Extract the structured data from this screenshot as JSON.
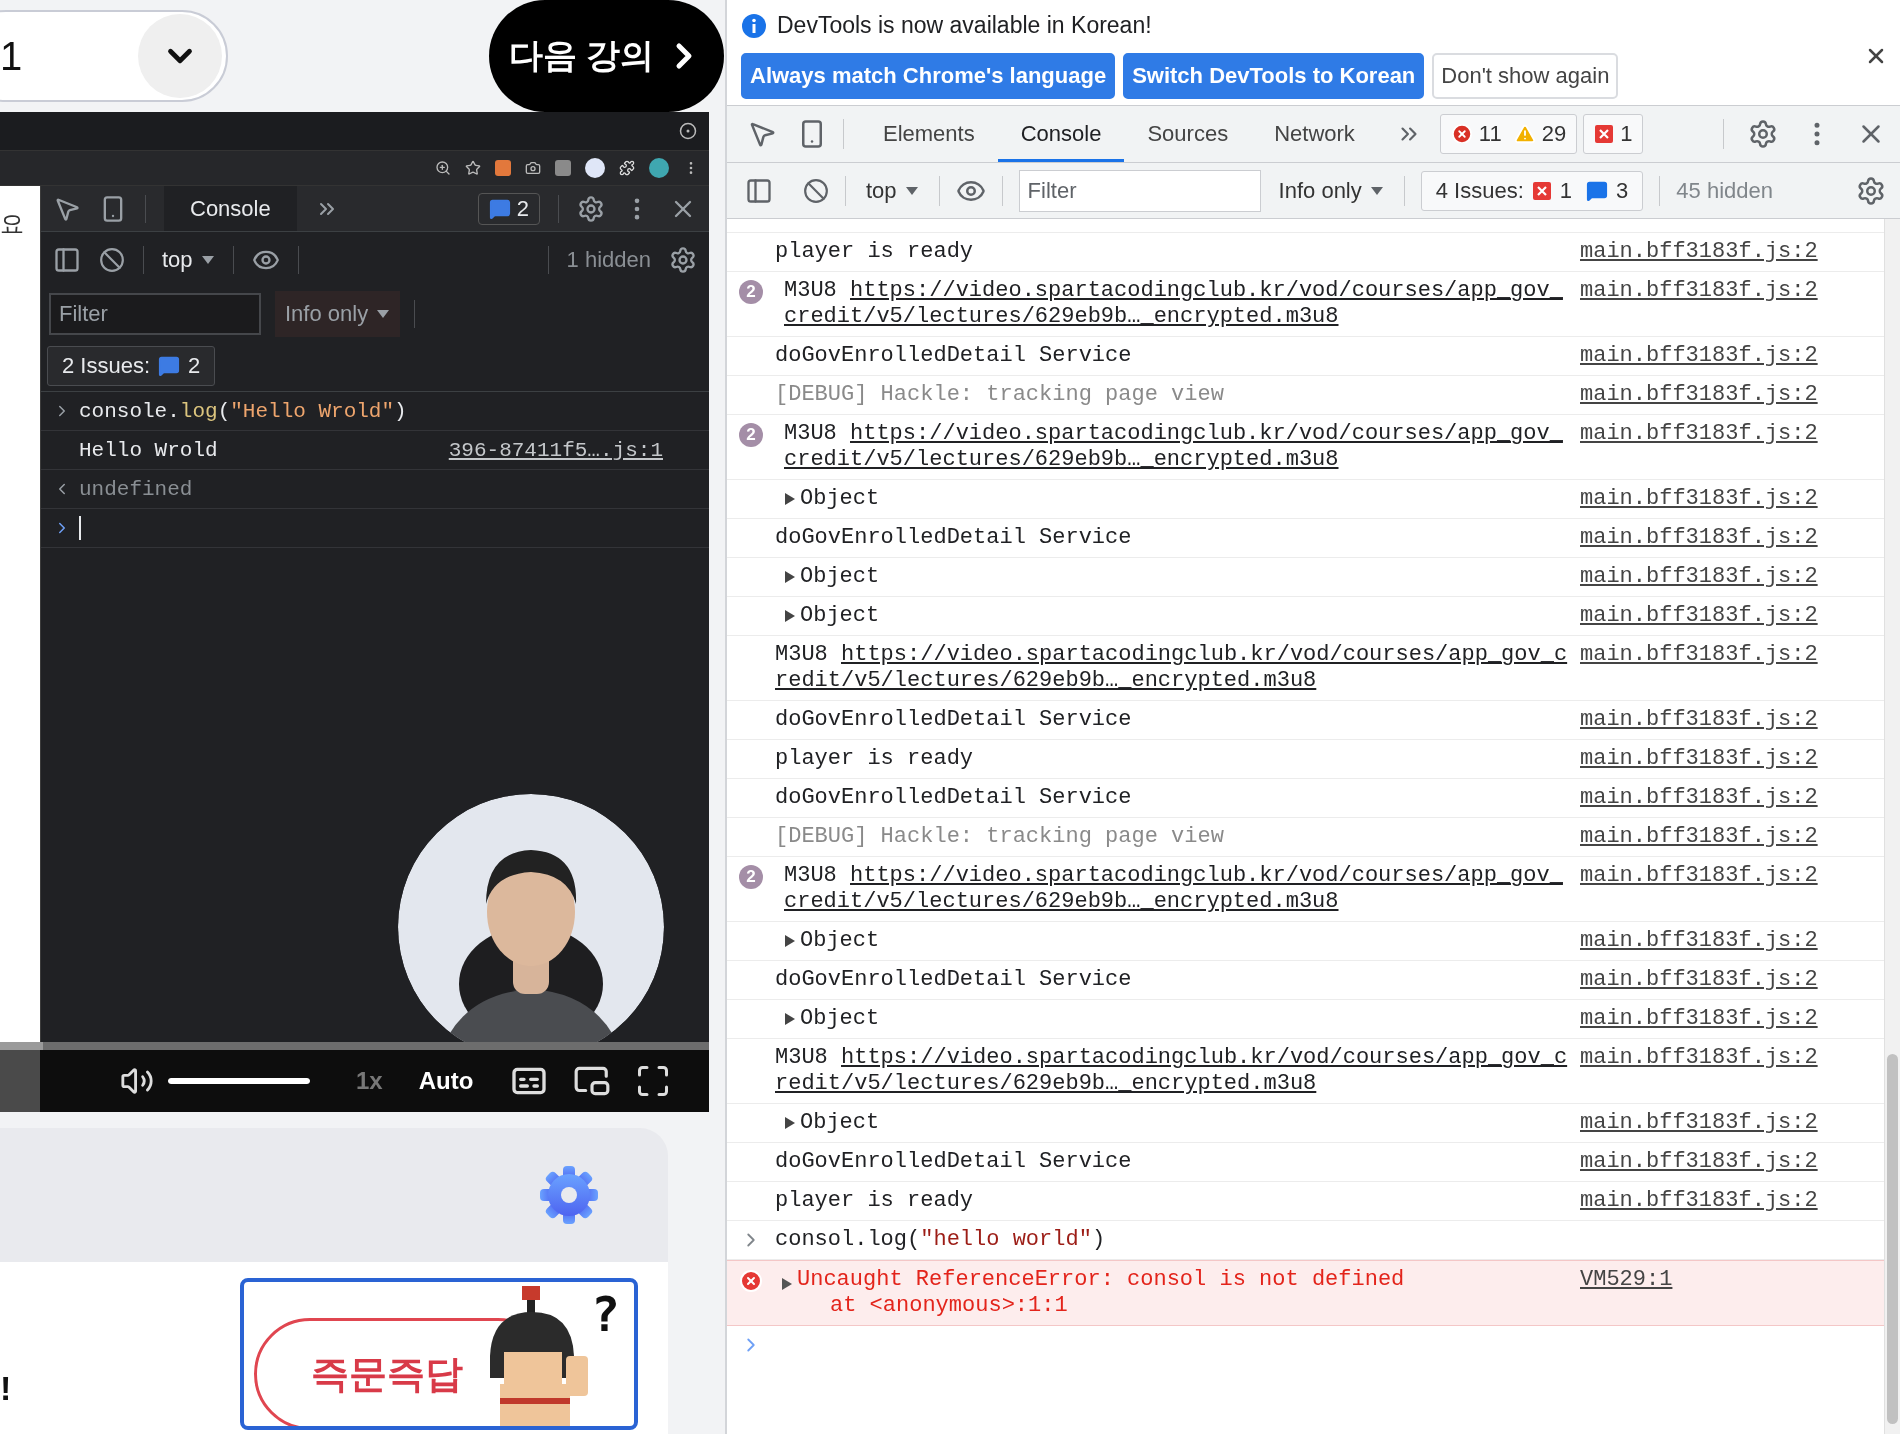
{
  "course_nav": {
    "lesson_select": "1",
    "next_button": "다음 강의"
  },
  "page_text": {
    "side": "요",
    "bottom": "!"
  },
  "video": {
    "devtools": {
      "tab": "Console",
      "message_badge": "2",
      "context": "top",
      "hidden": "1 hidden",
      "filter_placeholder": "Filter",
      "levels": "Info only",
      "issues_label": "2 Issues:",
      "issues_count": "2",
      "messages": [
        {
          "kind": "input",
          "tokens": [
            {
              "text": "console.",
              "kind": "plain"
            },
            {
              "text": "log",
              "kind": "method"
            },
            {
              "text": "(",
              "kind": "plain"
            },
            {
              "text": "\"Hello Wrold\"",
              "kind": "string"
            },
            {
              "text": ")",
              "kind": "plain"
            }
          ]
        },
        {
          "kind": "log",
          "text": "Hello Wrold",
          "source": "396-87411f5….js:1"
        },
        {
          "kind": "result",
          "text": "undefined"
        },
        {
          "kind": "prompt"
        }
      ]
    },
    "controls": {
      "progress": {
        "level": 0.06
      },
      "volume": {
        "level": 1
      },
      "speed": "1x",
      "quality": "Auto"
    }
  },
  "quiz_banner": {
    "label": "즉문즉답",
    "mark": "?"
  },
  "devtools": {
    "infobar": {
      "message": "DevTools is now available in Korean!",
      "buttons": [
        {
          "label": "Always match Chrome's language",
          "kind": "primary"
        },
        {
          "label": "Switch DevTools to Korean",
          "kind": "primary"
        },
        {
          "label": "Don't show again",
          "kind": "secondary"
        }
      ]
    },
    "tabs": [
      {
        "label": "Elements",
        "selected": false
      },
      {
        "label": "Console",
        "selected": true
      },
      {
        "label": "Sources",
        "selected": false
      },
      {
        "label": "Network",
        "selected": false
      }
    ],
    "counts": {
      "errors": "11",
      "warnings": "29",
      "issues": "1"
    },
    "toolbar": {
      "context": "top",
      "filter_placeholder": "Filter",
      "levels": "Info only",
      "issues_label": "4 Issues:",
      "issue_errors": "1",
      "issue_info": "3",
      "hidden": "45 hidden"
    },
    "messages": [
      {
        "kind": "log",
        "text": "player is ready",
        "source": "main.bff3183f.js:2"
      },
      {
        "kind": "url",
        "prefix": "M3U8",
        "url": "https://video.spartacodingclub.kr/vod/courses/app_gov_credit/v5/lectures/629eb9b…_encrypted.m3u8",
        "count": "2",
        "source": "main.bff3183f.js:2"
      },
      {
        "kind": "log",
        "text": "doGovEnrolledDetail Service",
        "source": "main.bff3183f.js:2"
      },
      {
        "kind": "debug",
        "text": "[DEBUG] Hackle: tracking page view",
        "source": "main.bff3183f.js:2"
      },
      {
        "kind": "url",
        "prefix": "M3U8",
        "url": "https://video.spartacodingclub.kr/vod/courses/app_gov_credit/v5/lectures/629eb9b…_encrypted.m3u8",
        "count": "2",
        "source": "main.bff3183f.js:2"
      },
      {
        "kind": "object",
        "text": "Object",
        "source": "main.bff3183f.js:2"
      },
      {
        "kind": "log",
        "text": "doGovEnrolledDetail Service",
        "source": "main.bff3183f.js:2"
      },
      {
        "kind": "object",
        "text": "Object",
        "source": "main.bff3183f.js:2"
      },
      {
        "kind": "object",
        "text": "Object",
        "source": "main.bff3183f.js:2"
      },
      {
        "kind": "url",
        "prefix": "M3U8",
        "url": "https://video.spartacodingclub.kr/vod/courses/app_gov_credit/v5/lectures/629eb9b…_encrypted.m3u8",
        "source": "main.bff3183f.js:2"
      },
      {
        "kind": "log",
        "text": "doGovEnrolledDetail Service",
        "source": "main.bff3183f.js:2"
      },
      {
        "kind": "log",
        "text": "player is ready",
        "source": "main.bff3183f.js:2"
      },
      {
        "kind": "log",
        "text": "doGovEnrolledDetail Service",
        "source": "main.bff3183f.js:2"
      },
      {
        "kind": "debug",
        "text": "[DEBUG] Hackle: tracking page view",
        "source": "main.bff3183f.js:2"
      },
      {
        "kind": "url",
        "prefix": "M3U8",
        "url": "https://video.spartacodingclub.kr/vod/courses/app_gov_credit/v5/lectures/629eb9b…_encrypted.m3u8",
        "count": "2",
        "source": "main.bff3183f.js:2"
      },
      {
        "kind": "object",
        "text": "Object",
        "source": "main.bff3183f.js:2"
      },
      {
        "kind": "log",
        "text": "doGovEnrolledDetail Service",
        "source": "main.bff3183f.js:2"
      },
      {
        "kind": "object",
        "text": "Object",
        "source": "main.bff3183f.js:2"
      },
      {
        "kind": "url",
        "prefix": "M3U8",
        "url": "https://video.spartacodingclub.kr/vod/courses/app_gov_credit/v5/lectures/629eb9b…_encrypted.m3u8",
        "source": "main.bff3183f.js:2"
      },
      {
        "kind": "object",
        "text": "Object",
        "source": "main.bff3183f.js:2"
      },
      {
        "kind": "log",
        "text": "doGovEnrolledDetail Service",
        "source": "main.bff3183f.js:2"
      },
      {
        "kind": "log",
        "text": "player is ready",
        "source": "main.bff3183f.js:2"
      },
      {
        "kind": "input",
        "tokens": [
          {
            "text": "consol.log(",
            "kind": "plain"
          },
          {
            "text": "\"hello world\"",
            "kind": "string"
          },
          {
            "text": ")",
            "kind": "plain"
          }
        ]
      },
      {
        "kind": "error",
        "text": "Uncaught ReferenceError: consol is not defined",
        "trace": "at <anonymous>:1:1",
        "source": "VM529:1"
      },
      {
        "kind": "prompt"
      }
    ]
  }
}
